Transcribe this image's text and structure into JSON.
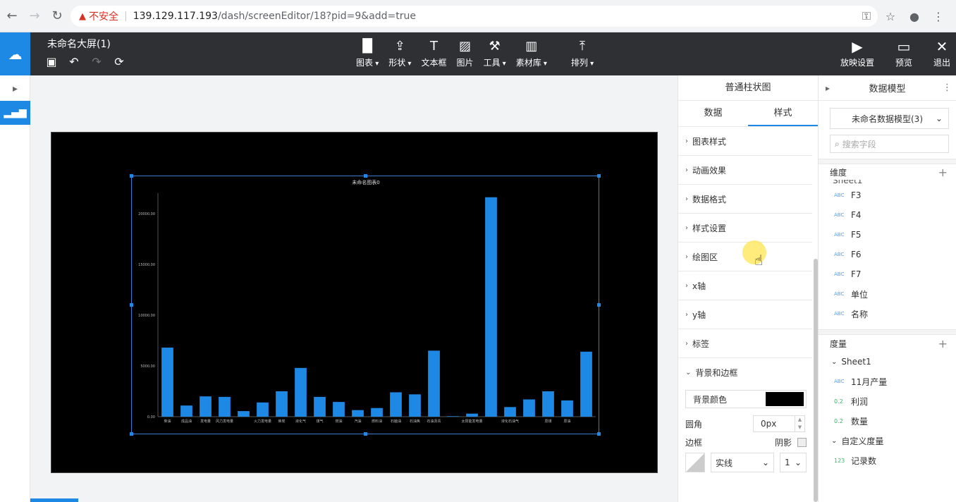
{
  "browser": {
    "insecure_label": "不安全",
    "url_host": "139.129.117.193",
    "url_path": "/dash/screenEditor/18?pid=9&add=true"
  },
  "header": {
    "title": "未命名大屏(1)",
    "center_tools": [
      {
        "label": "图表",
        "dropdown": true,
        "icon": "bar-chart-icon"
      },
      {
        "label": "形状",
        "dropdown": true,
        "icon": "shape-icon"
      },
      {
        "label": "文本框",
        "dropdown": false,
        "icon": "text-box-icon"
      },
      {
        "label": "图片",
        "dropdown": false,
        "icon": "image-icon"
      },
      {
        "label": "工具",
        "dropdown": true,
        "icon": "tool-icon"
      },
      {
        "label": "素材库",
        "dropdown": true,
        "icon": "library-icon"
      },
      {
        "label": "排列",
        "dropdown": true,
        "icon": "arrange-icon"
      }
    ],
    "right_tools": [
      {
        "label": "放映设置",
        "icon": "play-icon"
      },
      {
        "label": "预览",
        "icon": "preview-icon"
      },
      {
        "label": "退出",
        "icon": "close-icon"
      }
    ]
  },
  "chart_data": {
    "type": "bar",
    "title": "未命名图表0",
    "categories": [
      "柴油",
      "成品油",
      "发电量",
      "风力发电量",
      "",
      "火力发电量",
      "焦炭",
      "液化气",
      "煤气",
      "燃油",
      "汽油",
      "燃料油",
      "石脑油",
      "石油焦",
      "石油沥青",
      "",
      "太阳能发电量",
      "",
      "液化石油气",
      "",
      "原煤",
      "原油",
      ""
    ],
    "values": [
      6800,
      1100,
      2000,
      1950,
      550,
      1400,
      2500,
      4800,
      1950,
      1450,
      650,
      850,
      2400,
      2200,
      6500,
      50,
      300,
      21600,
      950,
      1700,
      2500,
      1600,
      6400
    ],
    "yticks": [
      "0.00",
      "5000.00",
      "10000.00",
      "15000.00",
      "20000.00"
    ],
    "ylim": [
      0,
      22000
    ],
    "bar_color": "#1e88e5"
  },
  "props": {
    "title": "普通柱状图",
    "tabs": [
      "数据",
      "样式"
    ],
    "active_tab": 1,
    "sections": [
      "图表样式",
      "动画效果",
      "数据格式",
      "样式设置",
      "绘图区",
      "x轴",
      "y轴",
      "标签",
      "背景和边框"
    ],
    "bg_color_label": "背景颜色",
    "bg_color": "#000000",
    "radius_label": "圆角",
    "radius_value": "0px",
    "border_label": "边框",
    "shadow_label": "阴影",
    "border_style": "实线",
    "border_width": "1"
  },
  "model": {
    "title": "数据模型",
    "selected_model": "未命名数据模型(3)",
    "search_placeholder": "搜索字段",
    "dimension_label": "维度",
    "sheet_label_dim": "Sheet1",
    "dimensions": [
      {
        "tag": "ABC",
        "name": "F3"
      },
      {
        "tag": "ABC",
        "name": "F4"
      },
      {
        "tag": "ABC",
        "name": "F5"
      },
      {
        "tag": "ABC",
        "name": "F6"
      },
      {
        "tag": "ABC",
        "name": "F7"
      },
      {
        "tag": "ABC",
        "name": "单位"
      },
      {
        "tag": "ABC",
        "name": "名称"
      }
    ],
    "measure_label": "度量",
    "sheet_label": "Sheet1",
    "measures": [
      {
        "tag": "ABC",
        "name": "11月产量"
      },
      {
        "tag": "0.2",
        "name": "利润"
      },
      {
        "tag": "0.2",
        "name": "数量"
      }
    ],
    "custom_label": "自定义度量",
    "custom_measures": [
      {
        "tag": "123",
        "name": "记录数"
      }
    ]
  }
}
